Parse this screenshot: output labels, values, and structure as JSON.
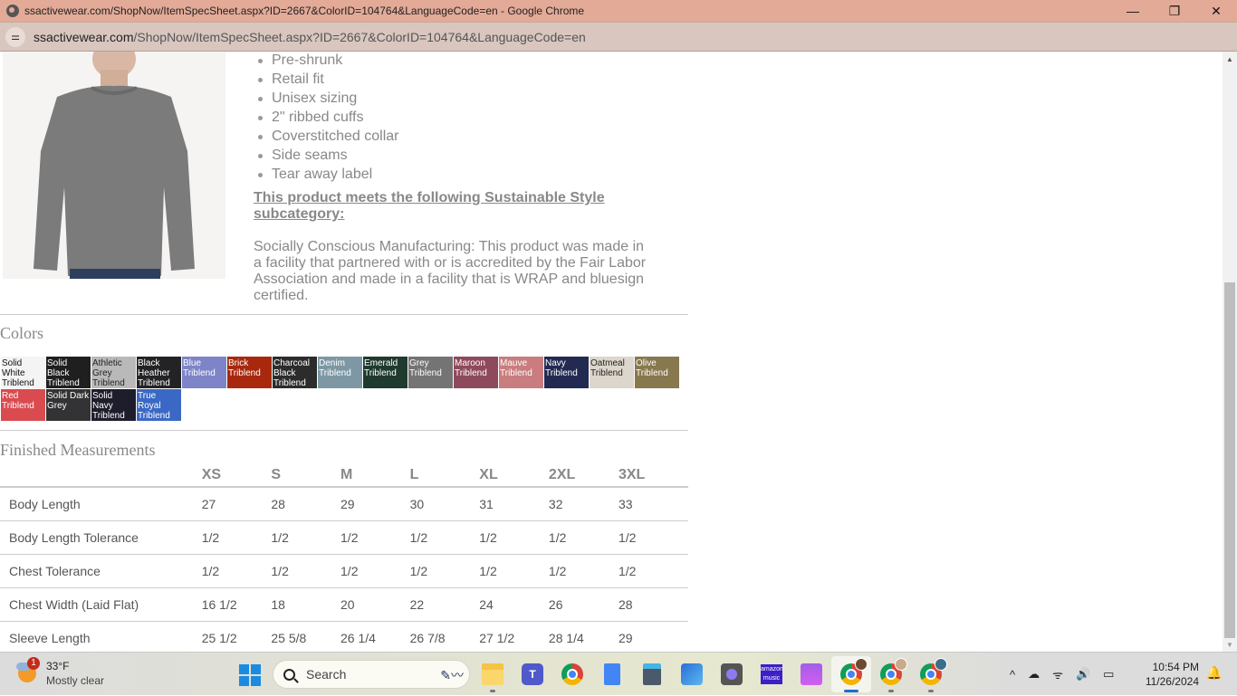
{
  "window": {
    "title": "ssactivewear.com/ShopNow/ItemSpecSheet.aspx?ID=2667&ColorID=104764&LanguageCode=en - Google Chrome",
    "minimize": "—",
    "restore": "❐",
    "close": "✕"
  },
  "address_bar": {
    "domain": "ssactivewear.com",
    "path": "/ShopNow/ItemSpecSheet.aspx?ID=2667&ColorID=104764&LanguageCode=en",
    "site_info_icon": "⚌"
  },
  "product": {
    "image_alt": "Model wearing grey triblend long sleeve tee",
    "features": [
      "Pre-shrunk",
      "Retail fit",
      "Unisex sizing",
      "2\" ribbed cuffs",
      "Coverstitched collar",
      "Side seams",
      "Tear away label"
    ],
    "sustainable_heading": "This product meets the following Sustainable Style subcategory:",
    "sustainable_text": "Socially Conscious Manufacturing: This product was made in a facility that partnered with or is accredited by the Fair Labor Association and made in a facility that is WRAP and bluesign certified."
  },
  "colors": {
    "title": "Colors",
    "swatches": [
      {
        "name": "Solid White Triblend",
        "bg": "#f4f4f4",
        "fg": "#111111"
      },
      {
        "name": "Solid Black Triblend",
        "bg": "#1f1f1f",
        "fg": "#ffffff"
      },
      {
        "name": "Athletic Grey Triblend",
        "bg": "#b9b9b9",
        "fg": "#222222"
      },
      {
        "name": "Black Heather Triblend",
        "bg": "#232325",
        "fg": "#ffffff"
      },
      {
        "name": "Blue Triblend",
        "bg": "#7d84c7",
        "fg": "#ffffff"
      },
      {
        "name": "Brick Triblend",
        "bg": "#a8280d",
        "fg": "#ffffff"
      },
      {
        "name": "Charcoal Black Triblend",
        "bg": "#2c2c2c",
        "fg": "#ffffff"
      },
      {
        "name": "Denim Triblend",
        "bg": "#7d98a4",
        "fg": "#ffffff"
      },
      {
        "name": "Emerald Triblend",
        "bg": "#1f3a2e",
        "fg": "#ffffff"
      },
      {
        "name": "Grey Triblend",
        "bg": "#747474",
        "fg": "#ffffff"
      },
      {
        "name": "Maroon Triblend",
        "bg": "#8e4a5c",
        "fg": "#ffffff"
      },
      {
        "name": "Mauve Triblend",
        "bg": "#c97d7f",
        "fg": "#ffffff"
      },
      {
        "name": "Navy Triblend",
        "bg": "#222a52",
        "fg": "#ffffff"
      },
      {
        "name": "Oatmeal Triblend",
        "bg": "#ddd6cc",
        "fg": "#222222"
      },
      {
        "name": "Olive Triblend",
        "bg": "#87784e",
        "fg": "#ffffff"
      },
      {
        "name": "Red Triblend",
        "bg": "#d94b4f",
        "fg": "#ffffff"
      },
      {
        "name": "Solid Dark Grey",
        "bg": "#333335",
        "fg": "#ffffff"
      },
      {
        "name": "Solid Navy Triblend",
        "bg": "#1d1d2b",
        "fg": "#ffffff"
      },
      {
        "name": "True Royal Triblend",
        "bg": "#3b68c4",
        "fg": "#ffffff"
      }
    ]
  },
  "measurements": {
    "title": "Finished Measurements",
    "sizes": [
      "XS",
      "S",
      "M",
      "L",
      "XL",
      "2XL",
      "3XL"
    ],
    "rows": [
      {
        "label": "Body Length",
        "values": [
          "27",
          "28",
          "29",
          "30",
          "31",
          "32",
          "33"
        ]
      },
      {
        "label": "Body Length Tolerance",
        "values": [
          "1/2",
          "1/2",
          "1/2",
          "1/2",
          "1/2",
          "1/2",
          "1/2"
        ]
      },
      {
        "label": "Chest Tolerance",
        "values": [
          "1/2",
          "1/2",
          "1/2",
          "1/2",
          "1/2",
          "1/2",
          "1/2"
        ]
      },
      {
        "label": "Chest Width (Laid Flat)",
        "values": [
          "16 1/2",
          "18",
          "20",
          "22",
          "24",
          "26",
          "28"
        ]
      },
      {
        "label": "Sleeve Length",
        "values": [
          "25 1/2",
          "25 5/8",
          "26 1/4",
          "26 7/8",
          "27 1/2",
          "28 1/4",
          "29"
        ]
      }
    ]
  },
  "scrollbar": {
    "up": "▲",
    "down": "▼",
    "position_fraction": 0.88
  },
  "taskbar": {
    "weather": {
      "temp": "33°F",
      "condition": "Mostly clear",
      "badge": "1"
    },
    "search_label": "Search",
    "pen_icon": "✎〰",
    "apps": [
      {
        "name": "file-explorer"
      },
      {
        "name": "teams",
        "glyph": "T"
      },
      {
        "name": "chrome"
      },
      {
        "name": "google-docs"
      },
      {
        "name": "calculator"
      },
      {
        "name": "photos"
      },
      {
        "name": "camera"
      },
      {
        "name": "amazon-music",
        "glyph": "amazon music"
      },
      {
        "name": "clipchamp"
      },
      {
        "name": "chrome-profile-1",
        "active": true
      },
      {
        "name": "chrome-profile-2"
      },
      {
        "name": "chrome-profile-3"
      }
    ],
    "tray": {
      "chevron": "^",
      "onedrive": "☁",
      "wifi": "ᯤ",
      "volume": "🔊",
      "battery": "▭"
    },
    "time": "10:54 PM",
    "date": "11/26/2024",
    "bell": "🔔"
  }
}
